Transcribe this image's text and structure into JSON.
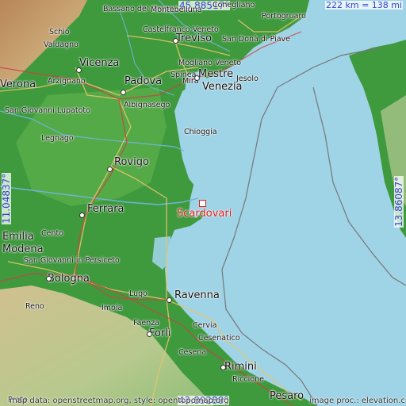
{
  "map": {
    "target_place": "Scardovari",
    "colors": {
      "sea": "#9fd3e6",
      "lowland": "#3f9a3e",
      "lowland_light": "#5cb04a",
      "hills": "#c8b98a",
      "mountains": "#b88a5a",
      "highlight": "#e0201a",
      "coord_text": "#3344cc"
    },
    "coordinates": {
      "top": "45.88517°",
      "bottom": "43.89288°",
      "left": "11.04837°",
      "right": "13.86087°"
    },
    "scale": "222 km = 138 mi",
    "attribution_left": "map data: openstreetmap.org, style: opentopomap.org",
    "attribution_right": "image proc.: elevation.city",
    "places": [
      "Bassano del Grappa",
      "Montebelluna",
      "Conegliano",
      "Portogruaro",
      "Schio",
      "Castelfranco Veneto",
      "Treviso",
      "San Donà di Piave",
      "Valdagno",
      "Vicenza",
      "Mogliano Veneto",
      "Mestre",
      "Jesolo",
      "Verona",
      "Arzignano",
      "Padova",
      "Spinea",
      "Mira",
      "Venezia",
      "San Giovanni Lupatoto",
      "Albignasego",
      "Chioggia",
      "Legnago",
      "Rovigo",
      "Ferrara",
      "Cento",
      "Emilia",
      "Modena",
      "San Giovanni in Persiceto",
      "Bologna",
      "Lugo",
      "Ravenna",
      "Imola",
      "Faenza",
      "Cervia",
      "Forlì",
      "Cesenatico",
      "Cesena",
      "Rimini",
      "Riccione",
      "Pesaro",
      "Reno",
      "Prato"
    ]
  }
}
